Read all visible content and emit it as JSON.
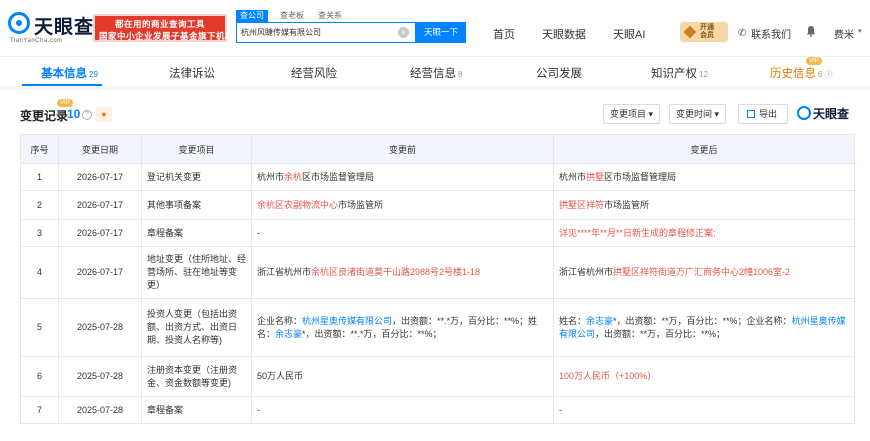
{
  "header": {
    "logo_text": "天眼查",
    "logo_sub": "TianYanCha.com",
    "promo_line1": "都在用的商业查询工具",
    "promo_line2": "国家中小企业发展子基金旗下机构",
    "search_tabs": [
      "查公司",
      "查老板",
      "查关系"
    ],
    "search_value": "杭州风睫传媒有限公司",
    "search_button": "天眼一下",
    "nav": [
      "首页",
      "天眼数据",
      "天眼AI"
    ],
    "vip_line1": "开通",
    "vip_line2": "会员",
    "contact": "联系我们",
    "user": "费米"
  },
  "section_tabs": [
    {
      "label": "基本信息",
      "count": "29"
    },
    {
      "label": "法律诉讼",
      "count": ""
    },
    {
      "label": "经营风险",
      "count": ""
    },
    {
      "label": "经营信息",
      "count": "8"
    },
    {
      "label": "公司发展",
      "count": ""
    },
    {
      "label": "知识产权",
      "count": "12"
    },
    {
      "label": "历史信息",
      "count": "6"
    }
  ],
  "vip_tag": "VIP",
  "records": {
    "title": "变更记录",
    "count": "10",
    "filter_item": "变更项目",
    "filter_time": "变更时间",
    "export": "导出",
    "brand": "天眼查"
  },
  "table": {
    "columns": [
      "序号",
      "变更日期",
      "变更项目",
      "变更前",
      "变更后"
    ],
    "rows": [
      {
        "no": "1",
        "date": "2026-07-17",
        "item": "登记机关变更",
        "before": [
          [
            "杭州市",
            ""
          ],
          [
            "余杭",
            "hl"
          ],
          [
            "区市场监督管理局",
            ""
          ]
        ],
        "after": [
          [
            "杭州市",
            ""
          ],
          [
            "拱墅",
            "hl"
          ],
          [
            "区市场监督管理局",
            ""
          ]
        ]
      },
      {
        "no": "2",
        "date": "2026-07-17",
        "item": "其他事项备案",
        "before": [
          [
            "余杭区农副物流中心",
            "hl"
          ],
          [
            "市场监管所",
            ""
          ]
        ],
        "after": [
          [
            "拱墅区祥符",
            "hl"
          ],
          [
            "市场监管所",
            ""
          ]
        ]
      },
      {
        "no": "3",
        "date": "2026-07-17",
        "item": "章程备案",
        "before": [
          [
            "-",
            ""
          ]
        ],
        "after": [
          [
            "详见****年**月**日新生成的章程修正案;",
            "hl"
          ]
        ]
      },
      {
        "no": "4",
        "date": "2026-07-17",
        "item": "地址变更（住所地址、经营场所、驻在地址等变更）",
        "before": [
          [
            "浙江省杭州市",
            ""
          ],
          [
            "余杭区良渚街道莫干山路2988号2号楼1-18",
            "hl"
          ]
        ],
        "after": [
          [
            "浙江省杭州市",
            ""
          ],
          [
            "拱墅区祥符街道万广汇商务中心2幢1006室-2",
            "hl"
          ]
        ]
      },
      {
        "no": "5",
        "date": "2025-07-28",
        "item": "投资人变更（包括出资额、出资方式、出资日期、投资人名称等)",
        "before": [
          [
            "企业名称：",
            ""
          ],
          [
            "杭州星奥传媒有限公司",
            "lnk"
          ],
          [
            "，出资额：**.*万，百分比：**%；姓名：",
            ""
          ],
          [
            "余志豪",
            "lnk"
          ],
          [
            "*，出资额：**.*万，百分比：**%；",
            ""
          ]
        ],
        "after": [
          [
            "姓名：",
            ""
          ],
          [
            "余志豪",
            "lnk"
          ],
          [
            "*，出资额：**万，百分比：**%；企业名称：",
            ""
          ],
          [
            "杭州星奥传媒有限公司",
            "lnk"
          ],
          [
            "，出资额：**万，百分比：**%；",
            ""
          ]
        ]
      },
      {
        "no": "6",
        "date": "2025-07-28",
        "item": "注册资本变更（注册资金、资金数额等变更)",
        "before": [
          [
            "50万人民币",
            ""
          ]
        ],
        "after": [
          [
            "100万人民币（+100%）",
            "hl"
          ]
        ]
      },
      {
        "no": "7",
        "date": "2025-07-28",
        "item": "章程备案",
        "before": [
          [
            "-",
            ""
          ]
        ],
        "after": [
          [
            "-",
            ""
          ]
        ]
      }
    ]
  },
  "colors": {
    "accent": "#0084ff",
    "highlight": "#e8554a",
    "vip": "#f0b850",
    "promo": "#e23a2b"
  }
}
